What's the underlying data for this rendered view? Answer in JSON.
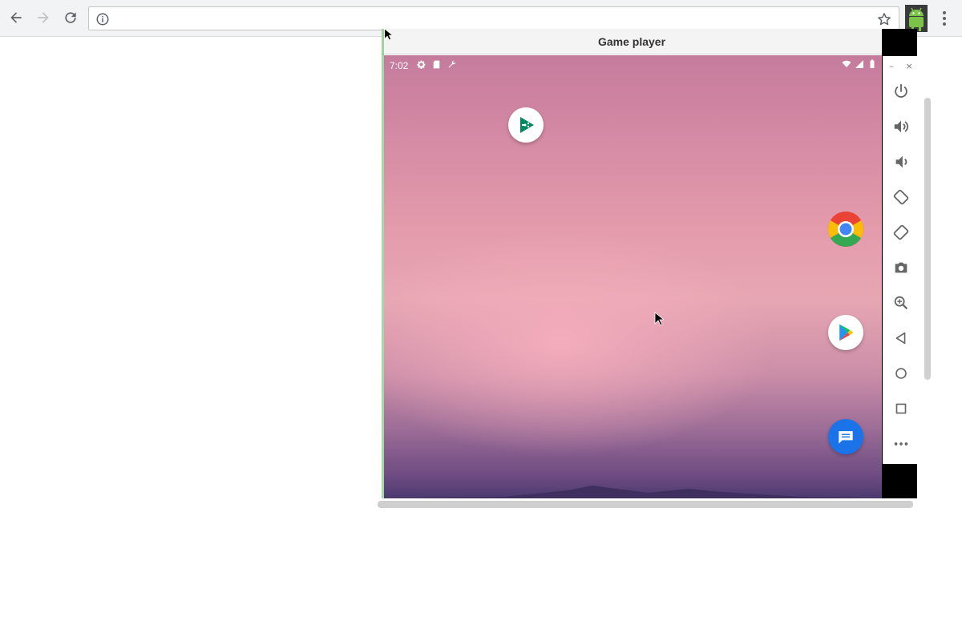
{
  "browser": {
    "address_value": "",
    "nav": {
      "back_icon": "back-arrow-icon",
      "forward_icon": "forward-arrow-icon",
      "reload_icon": "reload-icon"
    },
    "site_info_icon": "info-icon",
    "bookmark_icon": "star-icon",
    "extension_icon": "android-icon",
    "menu_icon": "kebab-menu-icon"
  },
  "player": {
    "title": "Game player",
    "window_controls": {
      "minimize": "–",
      "close": "×"
    }
  },
  "android": {
    "status": {
      "time": "7:02",
      "left_icons": [
        "settings-icon",
        "sd-card-icon",
        "wrench-icon"
      ],
      "right_icons": [
        "wifi-icon",
        "signal-icon",
        "battery-icon"
      ]
    },
    "apps": [
      {
        "name": "Play Games",
        "icon": "play-games-icon"
      },
      {
        "name": "Chrome",
        "icon": "chrome-icon"
      },
      {
        "name": "Play Store",
        "icon": "play-store-icon"
      },
      {
        "name": "Messages",
        "icon": "messages-icon"
      }
    ]
  },
  "emulator_toolbar": {
    "buttons": [
      "power",
      "volume-up",
      "volume-down",
      "rotate-left",
      "rotate-right",
      "screenshot",
      "zoom",
      "back",
      "home",
      "overview",
      "more"
    ]
  },
  "colors": {
    "accent_green": "#4caf50",
    "chrome_red": "#ea4335",
    "chrome_yellow": "#fbbc05",
    "chrome_green": "#34a853",
    "chrome_blue": "#4285f4",
    "messages_blue": "#1a73e8"
  }
}
